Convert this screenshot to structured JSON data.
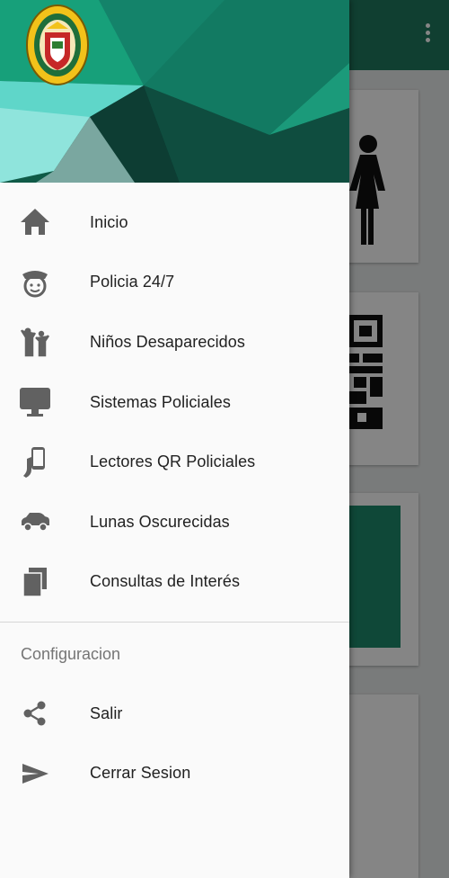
{
  "drawer": {
    "header": {
      "logo_icon": "police-emblem"
    },
    "main_items": [
      {
        "label": "Inicio",
        "icon": "home-icon"
      },
      {
        "label": "Policia 24/7",
        "icon": "police-officer-icon"
      },
      {
        "label": "Niños Desaparecidos",
        "icon": "children-icon"
      },
      {
        "label": "Sistemas Policiales",
        "icon": "monitor-icon"
      },
      {
        "label": "Lectores QR Policiales",
        "icon": "phone-in-hand-icon"
      },
      {
        "label": "Lunas Oscurecidas",
        "icon": "car-icon"
      },
      {
        "label": "Consultas de Interés",
        "icon": "copy-pages-icon"
      }
    ],
    "section_title": "Configuracion",
    "settings_items": [
      {
        "label": "Salir",
        "icon": "share-icon"
      },
      {
        "label": "Cerrar Sesion",
        "icon": "send-icon"
      }
    ]
  },
  "colors": {
    "header_dark": "#0f4d3f",
    "header_teal": "#1a9977",
    "header_light": "#5fd6c9",
    "icon_gray": "#616161"
  }
}
